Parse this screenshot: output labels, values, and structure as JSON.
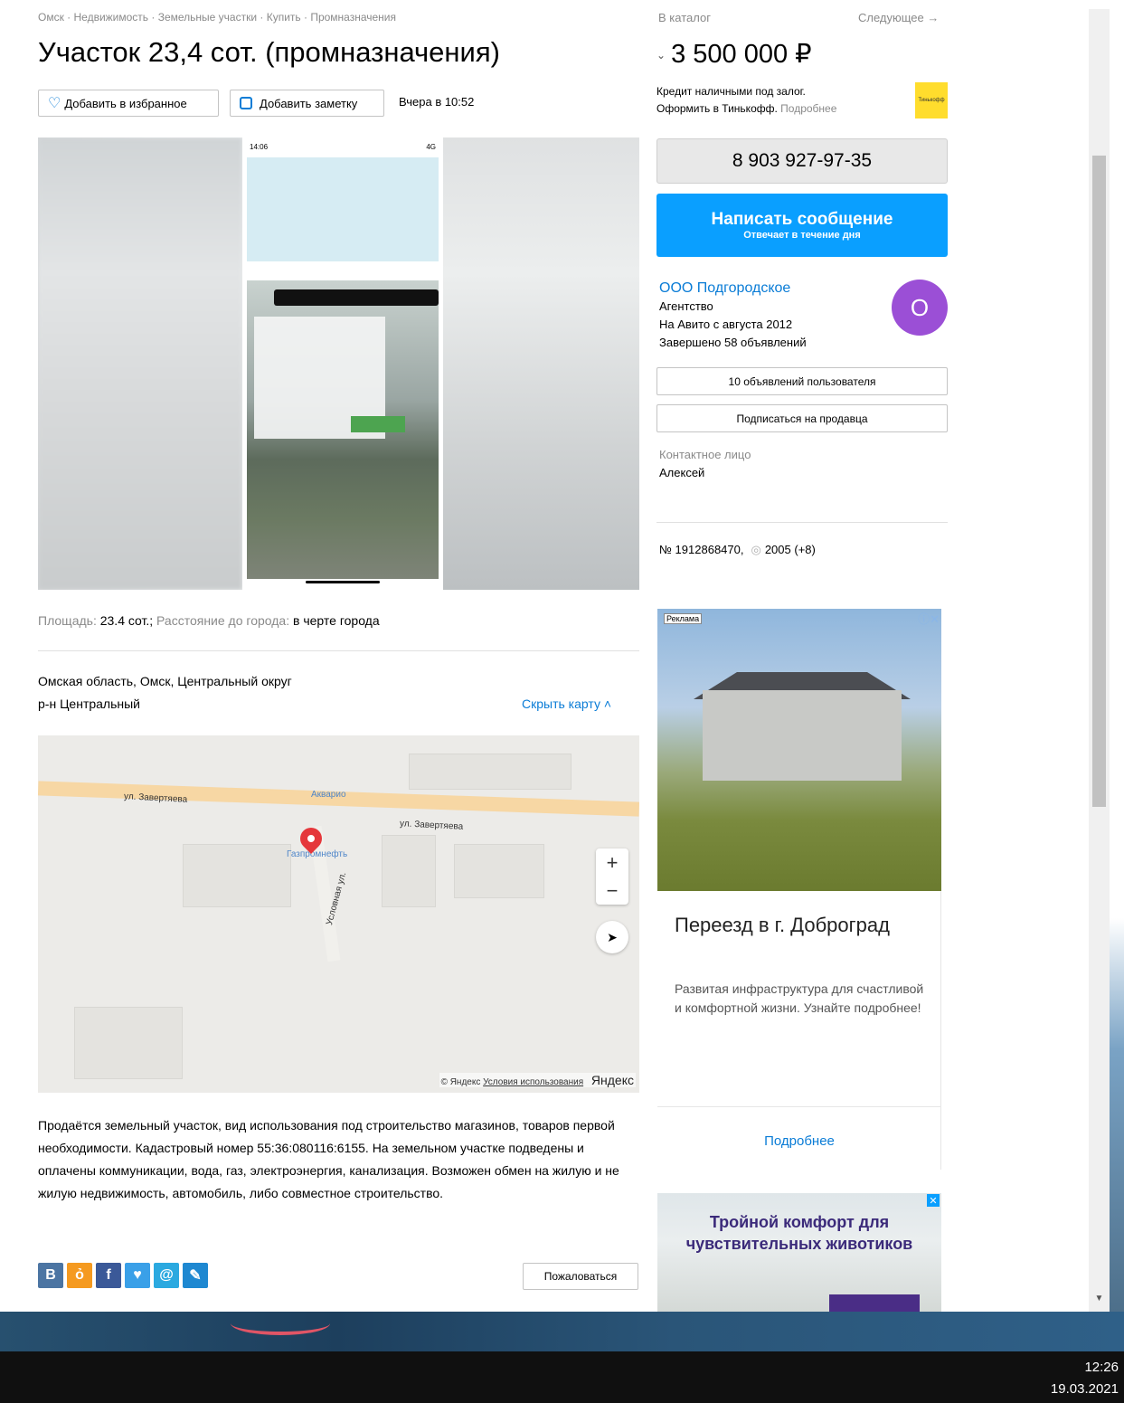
{
  "breadcrumb": "Омск · Недвижимость · Земельные участки · Купить · Промназначения",
  "title": "Участок 23,4 сот. (промназначения)",
  "actions": {
    "favorite_label": "Добавить в избранное",
    "note_label": "Добавить заметку",
    "posted": "Вчера в 10:52"
  },
  "gallery": {
    "phone_time": "14:06",
    "phone_signal": "4G"
  },
  "params": {
    "area_label": "Площадь:",
    "area_value": "23.4 сот.",
    "distance_label": "Расстояние до города:",
    "distance_value": "в черте города"
  },
  "address": {
    "line1": "Омская область, Омск, Центральный округ",
    "line2": "р-н Центральный",
    "hide_map": "Скрыть карту ˄"
  },
  "map": {
    "street1": "ул. Завертяева",
    "street2": "ул. Завертяева",
    "street3": "Условная ул.",
    "poi1": "Акварио",
    "poi2": "Газпромнефть",
    "zoom_in": "+",
    "zoom_out": "−",
    "copyright": "© Яндекс",
    "terms": "Условия использования",
    "logo": "Яндекс"
  },
  "description": "Продаётся земельный участок, вид использования под строительство магазинов, товаров первой необходимости. Кадастровый номер 55:36:080116:6155. На земельном участке подведены и оплачены коммуникации, вода, газ, электроэнергия, канализация. Возможен обмен на жилую и не жилую недвижимость, автомобиль, либо совместное строительство.",
  "share": {
    "vk": "В",
    "ok": "ok-icon",
    "fb": "f",
    "tw": "twitter-icon",
    "mail": "@",
    "lj": "lj-icon"
  },
  "complain_label": "Пожаловаться",
  "sidebar": {
    "catalog": "В каталог",
    "next": "Следующее →",
    "price": "3 500 000 ₽",
    "credit_line1": "Кредит наличными под залог.",
    "credit_line2": "Оформить в Тинькофф.",
    "credit_more": "Подробнее",
    "tinkoff_logo": "Тинькофф",
    "phone": "8 903 927-97-35",
    "message_title": "Написать сообщение",
    "message_sub": "Отвечает в течение дня",
    "seller_name": "ООО Подгородское",
    "seller_type": "Агентство",
    "seller_since": "На Авито с августа 2012",
    "seller_done": "Завершено 58 объявлений",
    "seller_avatar": "О",
    "user_ads": "10 объявлений пользователя",
    "subscribe": "Подписаться на продавца",
    "contact_label": "Контактное лицо",
    "contact_name": "Алексей",
    "ad_number": "№ 1912868470,",
    "views": "2005 (+8)"
  },
  "ad1": {
    "badge": "Реклама",
    "close": "ⓘ✕",
    "title": "Переезд в г. Доброград",
    "text": "Развитая инфраструктура для счастливой и комфортной жизни. Узнайте подробнее!",
    "more": "Подробнее"
  },
  "ad2": {
    "title": "Тройной комфорт для чувствительных животиков",
    "close": "✕"
  },
  "taskbar": {
    "time": "12:26",
    "date": "19.03.2021"
  },
  "colors": {
    "accent": "#0a7cd6",
    "message_button": "#0a9fff",
    "avatar": "#9b4fd6",
    "tinkoff": "#ffdd2d"
  }
}
